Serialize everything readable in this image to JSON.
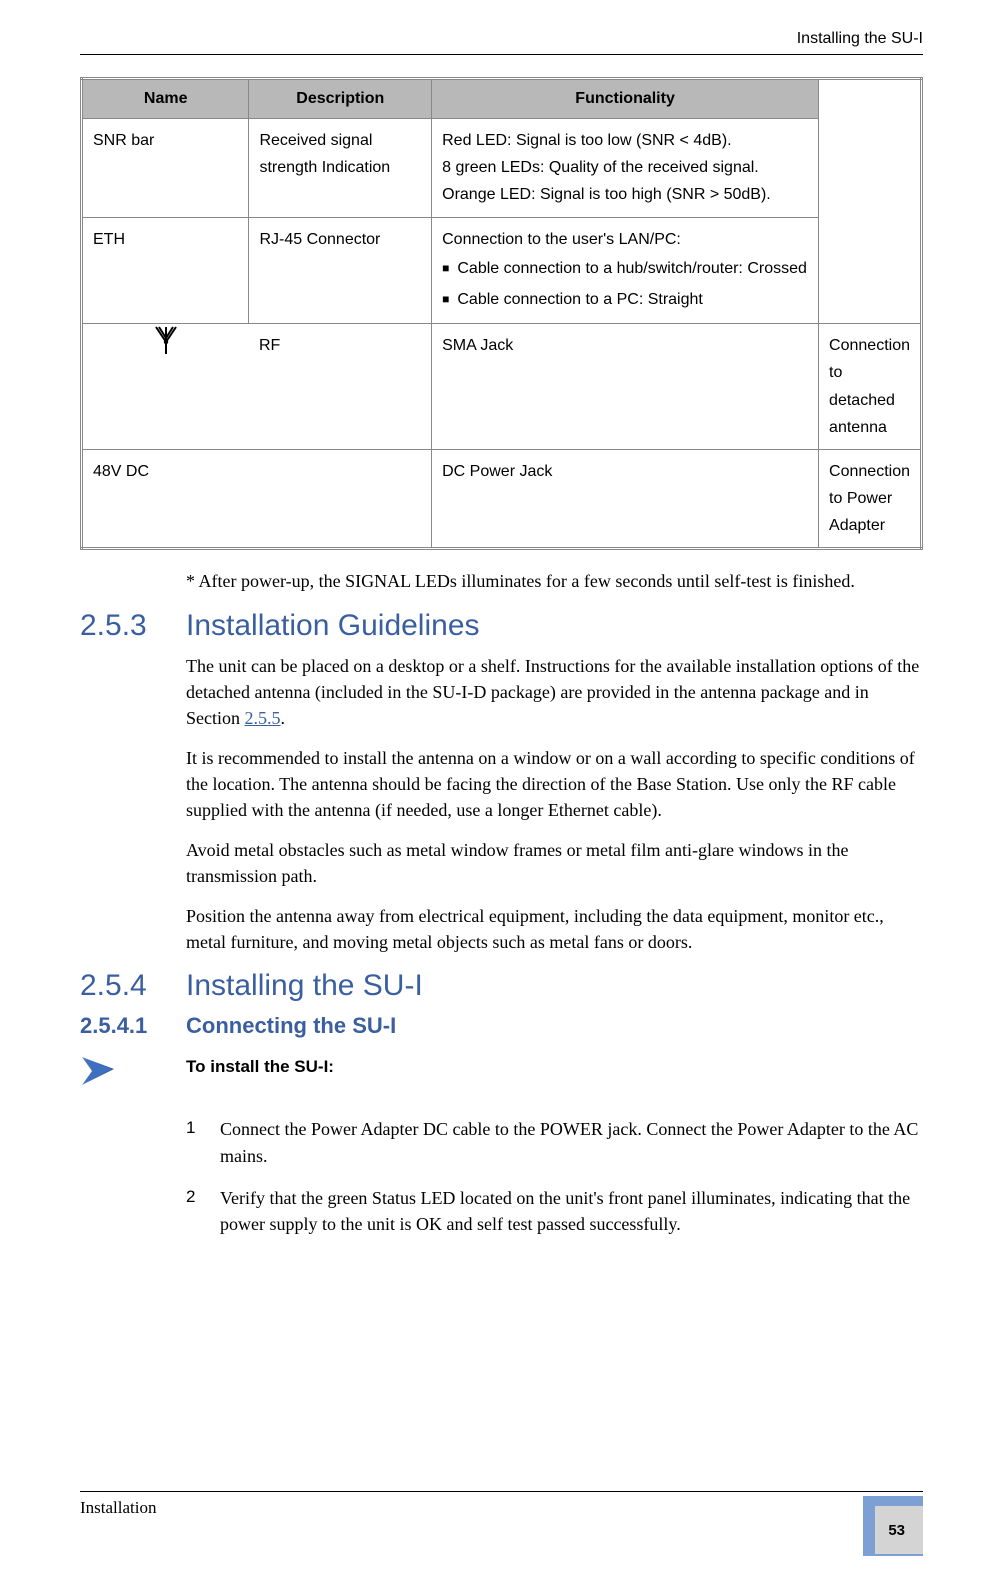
{
  "header": {
    "section_title": "Installing the SU-I"
  },
  "table": {
    "headers": {
      "name": "Name",
      "desc": "Description",
      "func": "Functionality"
    },
    "rows": {
      "r1": {
        "name": "SNR bar",
        "desc": "Received signal strength Indication",
        "func_l1": "Red LED: Signal is too low (SNR < 4dB).",
        "func_l2": "8 green LEDs: Quality of the received signal.",
        "func_l3": "Orange LED: Signal is too high (SNR > 50dB)."
      },
      "r2": {
        "name": "ETH",
        "desc": "RJ-45 Connector",
        "func_intro": "Connection to the user's LAN/PC:",
        "func_b1": "Cable connection to a hub/switch/router: Crossed",
        "func_b2": "Cable connection to a PC: Straight"
      },
      "r3": {
        "name": "RF",
        "desc": "SMA Jack",
        "func": "Connection to detached antenna"
      },
      "r4": {
        "name": "48V DC",
        "desc": "DC Power Jack",
        "func": "Connection to Power Adapter"
      }
    }
  },
  "note_p1": "* After power-up, the SIGNAL LEDs illuminates for a few seconds until self-test is finished.",
  "s253": {
    "num": "2.5.3",
    "title": "Installation Guidelines",
    "p1a": "The unit can be placed on a desktop or a shelf. Instructions for the available installation options of the detached antenna (included in the SU-I-D package) are provided in the antenna package and in Section ",
    "xref": "2.5.5",
    "p1b": ".",
    "p2": "It is recommended to install the antenna on a window or on a wall according to specific conditions of the location. The antenna should be facing the direction of the Base Station. Use only the RF cable supplied with the antenna (if needed, use a longer Ethernet cable).",
    "p3": "Avoid metal obstacles such as metal window frames or metal film anti-glare windows in the transmission path.",
    "p4": "Position the antenna away from electrical equipment, including the data equipment, monitor etc., metal furniture, and moving metal objects such as metal fans or doors."
  },
  "s254": {
    "num": "2.5.4",
    "title": "Installing the SU-I"
  },
  "s2541": {
    "num": "2.5.4.1",
    "title": "Connecting the SU-I",
    "inst_label": "To install the SU-I:",
    "step1": "Connect the Power Adapter DC cable to the POWER jack. Connect the Power Adapter to the AC mains.",
    "step2": "Verify that the green Status LED located on the unit's front panel illuminates, indicating that the power supply to the unit is OK and self test passed successfully."
  },
  "footer": {
    "chapter": "Installation",
    "page": "53"
  }
}
